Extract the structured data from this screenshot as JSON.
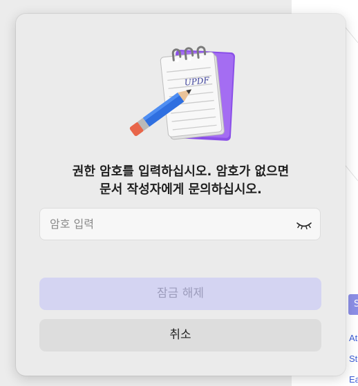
{
  "dialog": {
    "message_lines": [
      "권한 암호를 입력하십시오. 암호가 없으면",
      "문서 작성자에게 문의하십시오."
    ],
    "password_placeholder": "암호 입력",
    "password_value": "",
    "show_password_icon": "eye-closed-icon",
    "unlock_label": "잠금 해제",
    "unlock_enabled": false,
    "cancel_label": "취소",
    "app_icon": "notepad-pencil-icon",
    "app_icon_text": "UPDF"
  },
  "background": {
    "chip_label": "S",
    "links": [
      "At",
      "St",
      "Ea"
    ]
  },
  "colors": {
    "dialog_bg": "#ebebeb",
    "unlock_disabled_bg": "#d4d4f2",
    "cancel_bg": "#dddddd",
    "accent": "#8c8fe6"
  }
}
